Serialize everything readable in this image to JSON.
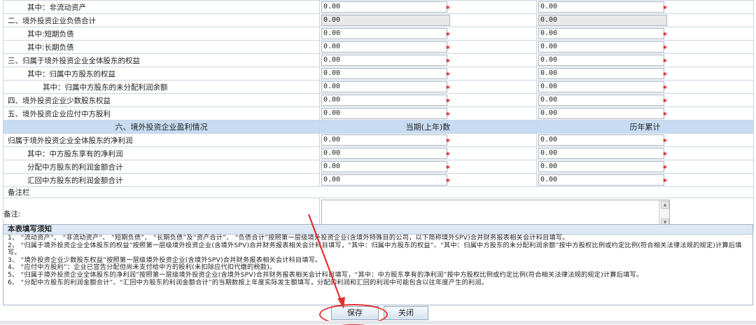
{
  "rows": [
    {
      "label": "其中：非流动资产",
      "cur": "0.00",
      "hist": "0.00"
    },
    {
      "label": "二、境外投资企业负债合计",
      "cur": "0.00",
      "hist": "0.00"
    },
    {
      "label": "其中:短期负债",
      "cur": "0.00",
      "hist": "0.00"
    },
    {
      "label": "其中:长期负债",
      "cur": "0.00",
      "hist": "0.00"
    },
    {
      "label": "三、归属于境外投资企业全体股东的权益",
      "cur": "0.00",
      "hist": "0.00"
    },
    {
      "label": "其中：归属中方股东的权益",
      "cur": "0.00",
      "hist": "0.00"
    },
    {
      "label": "其中：归属中方股东的未分配利润余额",
      "cur": "0.00",
      "hist": "0.00"
    },
    {
      "label": "四、境外投资企业少数股东权益",
      "cur": "0.00",
      "hist": "0.00"
    },
    {
      "label": "五、境外投资企业应付中方股利",
      "cur": "0.00",
      "hist": "0.00"
    }
  ],
  "profit_header": {
    "section": "六、境外投资企业盈利情况",
    "col_current": "当期(上年)数",
    "col_history": "历年累计"
  },
  "profit_rows": [
    {
      "label": "归属于境外投资企业全体股东的净利润",
      "cur": "0.00",
      "hist": "0.00"
    },
    {
      "label": "其中：中方股东享有的净利润",
      "cur": "0.00",
      "hist": "0.00"
    },
    {
      "label": "分配中方股东的利润金额合计",
      "cur": "0.00",
      "hist": "0.00"
    },
    {
      "label": "汇回中方股东的利润金额合计",
      "cur": "0.00",
      "hist": "0.00"
    }
  ],
  "remarks": {
    "section": "备注栏",
    "label": "备注:",
    "value": ""
  },
  "required_mark": "*",
  "notes": {
    "title": "本表填写须知",
    "lines": [
      "1、 “流动资产”、 “非流动资产”、 “短期负债”、 “长期负债”及“资产合计”、 “负债合计”按照第一层级境外投资企业(含境外特殊目的公司，以下简称境外SPV)合并财务报表相关会计科目填写。",
      "2、 “归属于境外投资企业全体股东的权益”按照第一层级境外投资企业(含境外SPV)合并财务报表相关会计科目填写，“其中：归属中方股东的权益”、“其中：归属中方股东的未分配利润余额”按中方股权比例或约定比例(符合相关法律法规的规定)计算后填写。",
      "3、 “境外投资企业少数股东权益”按照第一层级境外投资企业(含境外SPV)合并财务报表相关会计科目填写。",
      "4、 “应付中方股利”：企业已宣告分配但尚未支付给中方的股利(未扣除应代扣代缴的税款)。",
      "5、 “归属于境外投资企业全体股东的净利润”按照第一层级境外投资企业(含境外SPV)合并财务报表相关会计科目填写，“其中：中方股东享有的净利润”按中方股权比例或约定比例(符合相关法律法规的规定)计算后填写。",
      "6、 “分配中方股东的利润金额合计”、“汇回中方股东的利润金额合计”的当期数按上年度实际发生额填写，分配的利润和汇回的利润中可能包含以往年度产生的利润。"
    ]
  },
  "buttons": {
    "save": "保存",
    "close": "关闭"
  },
  "colors": {
    "header_bg": "#c7dcf2",
    "required": "#e00000",
    "annotation": "#e53030"
  }
}
